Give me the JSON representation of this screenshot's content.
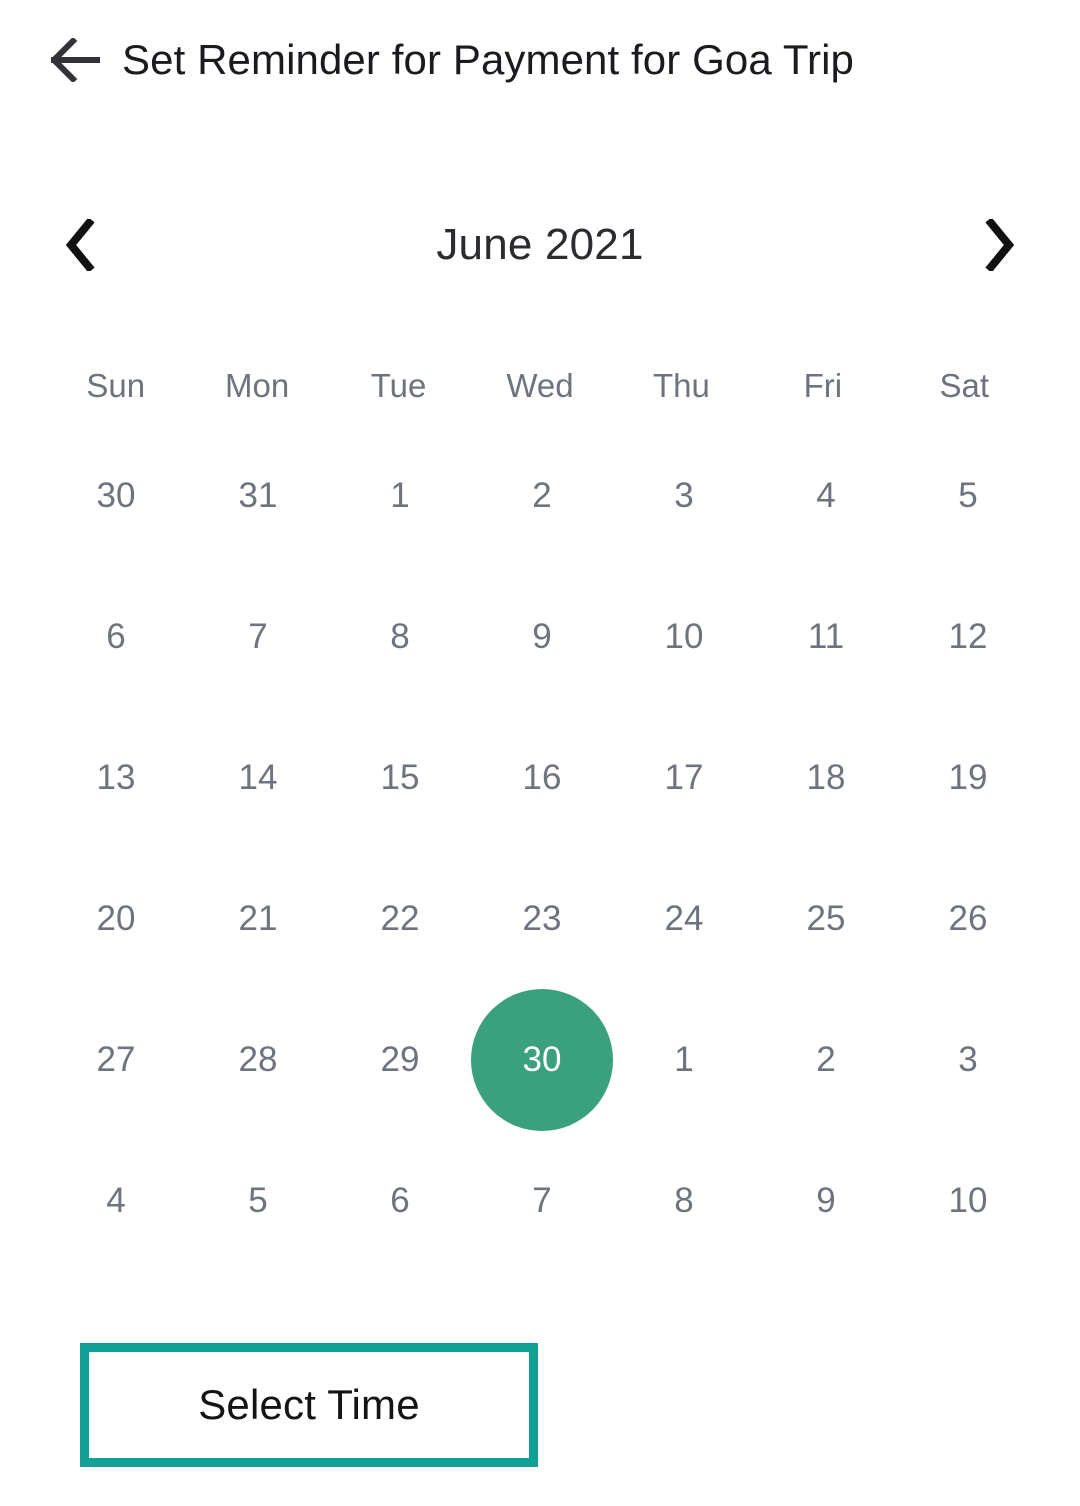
{
  "header": {
    "back_icon": "arrow-left-icon",
    "title": "Set Reminder for Payment for Goa Trip"
  },
  "month_nav": {
    "prev_icon": "chevron-left-icon",
    "next_icon": "chevron-right-icon",
    "label": "June 2021"
  },
  "calendar": {
    "weekdays": [
      "Sun",
      "Mon",
      "Tue",
      "Wed",
      "Thu",
      "Fri",
      "Sat"
    ],
    "selected_day": "30",
    "selected_weekday": "Wed",
    "weeks": [
      [
        {
          "label": "30",
          "current_month": false
        },
        {
          "label": "31",
          "current_month": false
        },
        {
          "label": "1",
          "current_month": true
        },
        {
          "label": "2",
          "current_month": true
        },
        {
          "label": "3",
          "current_month": true
        },
        {
          "label": "4",
          "current_month": true
        },
        {
          "label": "5",
          "current_month": true
        }
      ],
      [
        {
          "label": "6",
          "current_month": true
        },
        {
          "label": "7",
          "current_month": true
        },
        {
          "label": "8",
          "current_month": true
        },
        {
          "label": "9",
          "current_month": true
        },
        {
          "label": "10",
          "current_month": true
        },
        {
          "label": "11",
          "current_month": true
        },
        {
          "label": "12",
          "current_month": true
        }
      ],
      [
        {
          "label": "13",
          "current_month": true
        },
        {
          "label": "14",
          "current_month": true
        },
        {
          "label": "15",
          "current_month": true
        },
        {
          "label": "16",
          "current_month": true
        },
        {
          "label": "17",
          "current_month": true
        },
        {
          "label": "18",
          "current_month": true
        },
        {
          "label": "19",
          "current_month": true
        }
      ],
      [
        {
          "label": "20",
          "current_month": true
        },
        {
          "label": "21",
          "current_month": true
        },
        {
          "label": "22",
          "current_month": true
        },
        {
          "label": "23",
          "current_month": true
        },
        {
          "label": "24",
          "current_month": true
        },
        {
          "label": "25",
          "current_month": true
        },
        {
          "label": "26",
          "current_month": true
        }
      ],
      [
        {
          "label": "27",
          "current_month": true
        },
        {
          "label": "28",
          "current_month": true
        },
        {
          "label": "29",
          "current_month": true
        },
        {
          "label": "30",
          "current_month": true,
          "selected": true
        },
        {
          "label": "1",
          "current_month": false
        },
        {
          "label": "2",
          "current_month": false
        },
        {
          "label": "3",
          "current_month": false
        }
      ],
      [
        {
          "label": "4",
          "current_month": false
        },
        {
          "label": "5",
          "current_month": false
        },
        {
          "label": "6",
          "current_month": false
        },
        {
          "label": "7",
          "current_month": false
        },
        {
          "label": "8",
          "current_month": false
        },
        {
          "label": "9",
          "current_month": false
        },
        {
          "label": "10",
          "current_month": false
        }
      ]
    ]
  },
  "footer": {
    "select_time_label": "Select Time"
  },
  "colors": {
    "selected_day_background": "#3ba07e",
    "selected_day_text": "#ffffff",
    "button_border": "#10a094",
    "day_text": "#6e737e",
    "title_text": "#1b1b1f",
    "page_background": "#ffffff"
  }
}
